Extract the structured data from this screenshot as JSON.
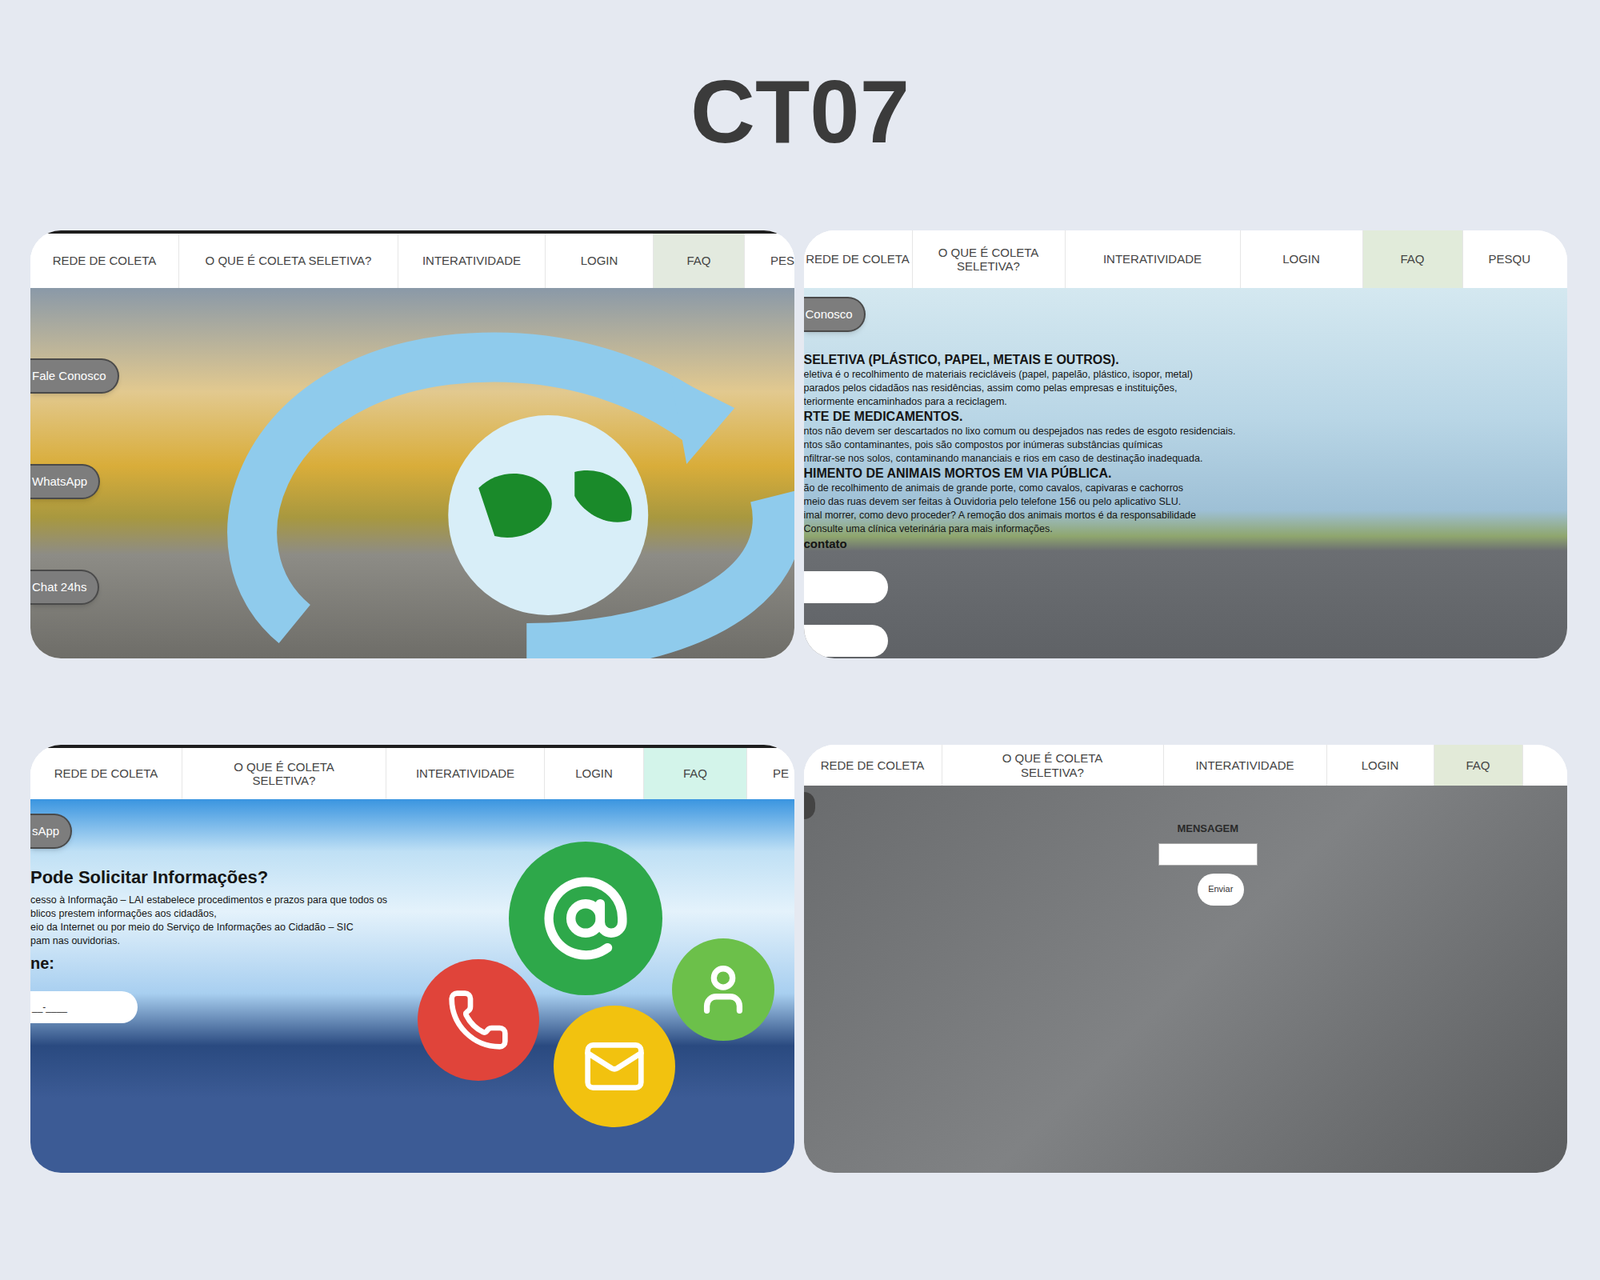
{
  "slide": {
    "title": "CT07"
  },
  "panels": [
    {
      "kind": "home",
      "nav": [
        {
          "label": "REDE DE COLETA",
          "selected": false
        },
        {
          "label": "O QUE É COLETA SELETIVA?",
          "selected": false
        },
        {
          "label": "INTERATIVIDADE",
          "selected": false
        },
        {
          "label": "LOGIN",
          "selected": false
        },
        {
          "label": "FAQ",
          "selected": true
        },
        {
          "label": "PES",
          "selected": false
        }
      ],
      "side_buttons": [
        "Fale Conosco",
        "WhatsApp",
        "Chat 24hs"
      ]
    },
    {
      "kind": "info",
      "nav": [
        {
          "label": "REDE DE COLETA",
          "selected": false
        },
        {
          "label": "O QUE É COLETA SELETIVA?",
          "selected": false
        },
        {
          "label": "INTERATIVIDADE",
          "selected": false
        },
        {
          "label": "LOGIN",
          "selected": false
        },
        {
          "label": "FAQ",
          "selected": true
        },
        {
          "label": "PESQU",
          "selected": false
        }
      ],
      "side_button": "Conosco",
      "sections": [
        {
          "heading": "SELETIVA (PLÁSTICO, PAPEL, METAIS E OUTROS).",
          "lines": [
            "eletiva é o recolhimento de materiais recicláveis (papel, papelão, plástico, isopor, metal)",
            "parados pelos cidadãos nas residências, assim como pelas empresas e instituições,",
            "teriormente encaminhados para a reciclagem."
          ]
        },
        {
          "heading": "RTE DE MEDICAMENTOS.",
          "lines": [
            "ntos não devem ser descartados no lixo comum ou despejados nas redes de esgoto residenciais.",
            "ntos são contaminantes, pois são compostos por inúmeras substâncias químicas",
            "nfiltrar-se nos solos, contaminando mananciais e rios em caso de destinação inadequada."
          ]
        },
        {
          "heading": "HIMENTO DE ANIMAIS MORTOS EM VIA PÚBLICA.",
          "lines": [
            "ão de recolhimento de animais de grande porte, como cavalos, capivaras e cachorros",
            "meio das ruas devem ser feitas à Ouvidoria pelo telefone 156 ou pelo aplicativo SLU.",
            "imal morrer, como devo proceder? A remoção dos animais mortos é da responsabilidade",
            "Consulte uma clínica veterinária para mais informações."
          ]
        }
      ],
      "contact_label": "contato"
    },
    {
      "kind": "contact",
      "nav": [
        {
          "label": "REDE DE COLETA",
          "selected": false
        },
        {
          "label": "O QUE É COLETA SELETIVA?",
          "selected": false
        },
        {
          "label": "INTERATIVIDADE",
          "selected": false
        },
        {
          "label": "LOGIN",
          "selected": false
        },
        {
          "label": "FAQ",
          "selected": true
        },
        {
          "label": "PE",
          "selected": false
        }
      ],
      "side_button": "sApp",
      "heading": "Pode Solicitar Informações?",
      "lines": [
        "cesso à Informação – LAI estabelece procedimentos e prazos para que todos os",
        "blicos prestem informações aos cidadãos,",
        "eio da Internet ou por meio do Serviço de Informações ao Cidadão – SIC",
        "pam nas ouvidorias."
      ],
      "field_label": "ne:",
      "field_value": "__-____"
    },
    {
      "kind": "message",
      "nav": [
        {
          "label": "REDE DE COLETA",
          "selected": false
        },
        {
          "label": "O QUE É COLETA SELETIVA?",
          "selected": false
        },
        {
          "label": "INTERATIVIDADE",
          "selected": false
        },
        {
          "label": "LOGIN",
          "selected": false
        },
        {
          "label": "FAQ",
          "selected": true
        }
      ],
      "field_label": "MENSAGEM",
      "button": "Enviar"
    }
  ]
}
